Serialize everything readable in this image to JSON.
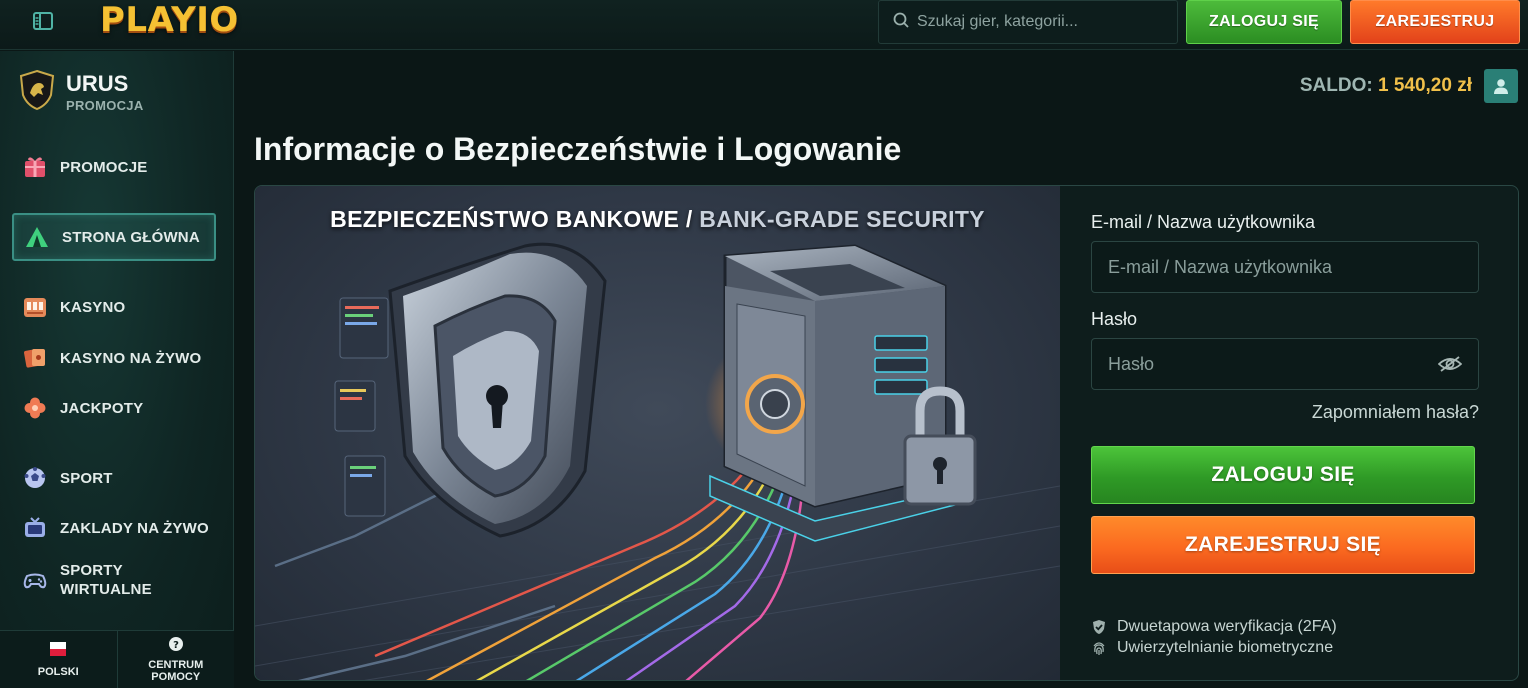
{
  "header": {
    "logo_text": "PLAYIO",
    "search_placeholder": "Szukaj gier, kategorii...",
    "login_label": "ZALOGUJ SIĘ",
    "register_label": "ZAREJESTRUJ"
  },
  "sidebar": {
    "promo": {
      "title": "URUS",
      "subtitle": "PROMOCJA"
    },
    "items": [
      {
        "label": "PROMOCJE",
        "icon": "gift-icon"
      },
      {
        "label": "STRONA GŁÓWNA",
        "icon": "home-tent-icon",
        "active": true
      },
      {
        "label": "KASYNO",
        "icon": "slot-machine-icon"
      },
      {
        "label": "KASYNO NA ŻYWO",
        "icon": "playing-cards-icon"
      },
      {
        "label": "JACKPOTY",
        "icon": "clover-icon"
      },
      {
        "label": "SPORT",
        "icon": "soccer-ball-icon"
      },
      {
        "label": "ZAKLADY NA ŻYWO",
        "icon": "live-tv-icon"
      },
      {
        "label": "SPORTY WIRTUALNE",
        "icon": "gamepad-icon"
      }
    ],
    "footer": {
      "language": "POLSKI",
      "help": "CENTRUM POMOCY"
    }
  },
  "account": {
    "balance_label": "SALDO:",
    "balance_value": "1 540,20 zł"
  },
  "main": {
    "title": "Informacje o Bezpieczeństwie i Logowanie",
    "hero": {
      "title_main": "BEZPIECZEŃSTWO BANKOWE /",
      "title_en": "BANK-GRADE SECURITY"
    },
    "form": {
      "email_label": "E-mail / Nazwa użytkownika",
      "email_placeholder": "E-mail / Nazwa użytkownika",
      "password_label": "Hasło",
      "password_placeholder": "Hasło",
      "forgot_label": "Zapomniałem hasła?",
      "login_button": "ZALOGUJ SIĘ",
      "register_button": "ZAREJESTRUJ SIĘ",
      "features": [
        {
          "label": "Dwuetapowa weryfikacja (2FA)",
          "icon": "shield-check-icon"
        },
        {
          "label": "Uwierzytelnianie biometryczne",
          "icon": "fingerprint-icon"
        }
      ]
    }
  },
  "colors": {
    "accent_teal": "#2a7f76",
    "login_green": "#3aa52d",
    "register_orange": "#f7641f",
    "balance_gold": "#f1c04a"
  }
}
